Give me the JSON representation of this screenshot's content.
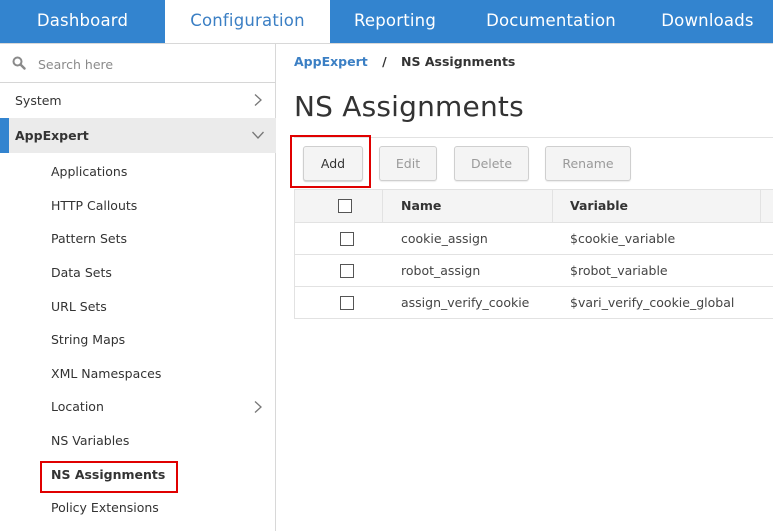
{
  "topnav": {
    "tabs": [
      {
        "label": "Dashboard",
        "active": false
      },
      {
        "label": "Configuration",
        "active": true
      },
      {
        "label": "Reporting",
        "active": false
      },
      {
        "label": "Documentation",
        "active": false
      },
      {
        "label": "Downloads",
        "active": false
      }
    ]
  },
  "sidebar": {
    "search": {
      "placeholder": "Search here",
      "value": "",
      "icon": "search-icon"
    },
    "items": [
      {
        "label": "System",
        "icon": "chevron-right-icon",
        "expanded": false
      },
      {
        "label": "AppExpert",
        "icon": "chevron-down-icon",
        "expanded": true
      }
    ],
    "sub_items": [
      {
        "label": "Applications"
      },
      {
        "label": "HTTP Callouts"
      },
      {
        "label": "Pattern Sets"
      },
      {
        "label": "Data Sets"
      },
      {
        "label": "URL Sets"
      },
      {
        "label": "String Maps"
      },
      {
        "label": "XML Namespaces"
      },
      {
        "label": "Location",
        "icon": "chevron-right-icon"
      },
      {
        "label": "NS Variables"
      },
      {
        "label": "NS Assignments",
        "active": true
      },
      {
        "label": "Policy Extensions"
      }
    ]
  },
  "main": {
    "breadcrumb": {
      "parent": "AppExpert",
      "separator": "/",
      "current": "NS Assignments"
    },
    "title": "NS Assignments",
    "toolbar": {
      "add_label": "Add",
      "edit_label": "Edit",
      "delete_label": "Delete",
      "rename_label": "Rename"
    },
    "table": {
      "columns": [
        "Name",
        "Variable"
      ],
      "rows": [
        {
          "name": "cookie_assign",
          "variable": "$cookie_variable"
        },
        {
          "name": "robot_assign",
          "variable": "$robot_variable"
        },
        {
          "name": "assign_verify_cookie",
          "variable": "$vari_verify_cookie_global"
        }
      ]
    }
  },
  "colors": {
    "brand_blue": "#3384cf",
    "link_blue": "#3b7fc4",
    "highlight_red": "#e00000"
  }
}
